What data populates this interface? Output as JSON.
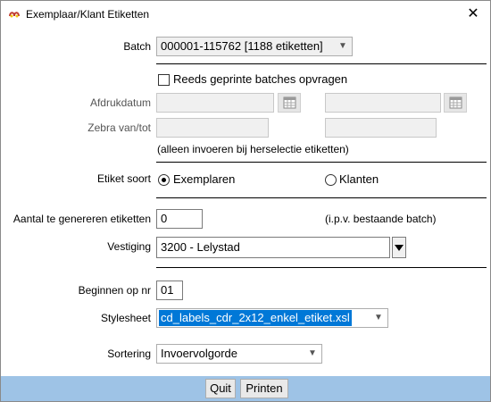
{
  "window": {
    "title": "Exemplaar/Klant Etiketten",
    "close_glyph": "✕",
    "icon": "app-logo-icon"
  },
  "batch": {
    "label": "Batch",
    "value": "000001-115762 [1188 etiketten]"
  },
  "printed_batches": {
    "label": "Reeds geprinte batches opvragen",
    "checked": false
  },
  "print_date": {
    "label": "Afdrukdatum",
    "from": "",
    "to": ""
  },
  "zebra": {
    "label": "Zebra van/tot",
    "from": "",
    "to": ""
  },
  "reselect_note": "(alleen invoeren bij herselectie etiketten)",
  "label_type": {
    "label": "Etiket soort",
    "options": [
      "Exemplaren",
      "Klanten"
    ],
    "selected": "Exemplaren"
  },
  "generate_count": {
    "label": "Aantal te genereren etiketten",
    "value": "0",
    "note": "(i.p.v. bestaande batch)"
  },
  "branch": {
    "label": "Vestiging",
    "value": "3200 - Lelystad"
  },
  "start_number": {
    "label": "Beginnen op nr",
    "value": "01"
  },
  "stylesheet": {
    "label": "Stylesheet",
    "value": "cd_labels_cdr_2x12_enkel_etiket.xsl"
  },
  "sorting": {
    "label": "Sortering",
    "value": "Invoervolgorde"
  },
  "buttons": {
    "quit": "Quit",
    "print": "Printen"
  },
  "colors": {
    "footer": "#9ec3e6",
    "selection": "#0078d7"
  }
}
